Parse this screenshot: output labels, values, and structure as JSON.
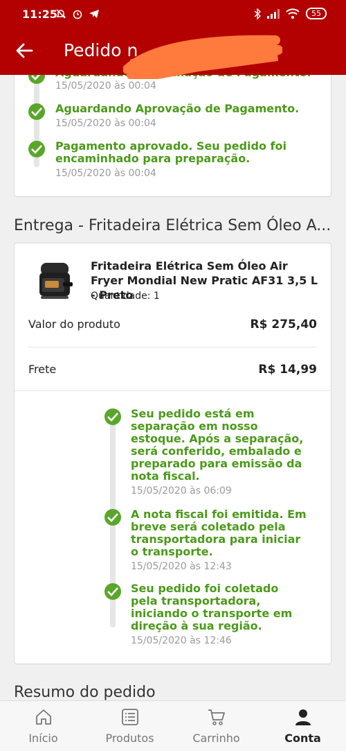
{
  "status": {
    "time": "11:25",
    "battery": "55"
  },
  "header": {
    "title": "Pedido n"
  },
  "payment_timeline": [
    {
      "text": "Aguardando Confirmação de Pagamento.",
      "date": "15/05/2020 às 00:04"
    },
    {
      "text": "Aguardando Aprovação de Pagamento.",
      "date": "15/05/2020 às 00:04"
    },
    {
      "text": "Pagamento aprovado. Seu pedido foi encaminhado para preparação.",
      "date": "15/05/2020 às 00:04"
    }
  ],
  "delivery": {
    "title": "Entrega - Fritadeira Elétrica Sem Óleo A...",
    "product_name": "Fritadeira Elétrica Sem Óleo Air Fryer Mondial New Pratic AF31 3,5 L - Preto",
    "quantity": "Quantidade: 1",
    "product_value_label": "Valor do produto",
    "product_value": "R$ 275,40",
    "shipping_label": "Frete",
    "shipping_value": "R$ 14,99",
    "timeline": [
      {
        "text": "Seu pedido está em separação em nosso estoque. Após a separação, será conferido, embalado e preparado para emissão da nota fiscal.",
        "date": "15/05/2020 às 06:09"
      },
      {
        "text": "A nota fiscal foi emitida. Em breve será coletado pela transportadora para iniciar o transporte.",
        "date": "15/05/2020 às 12:43"
      },
      {
        "text": "Seu pedido foi coletado pela transportadora, iniciando o transporte em direção à sua região.",
        "date": "15/05/2020 às 12:46"
      }
    ]
  },
  "summary": {
    "title": "Resumo do pedido"
  },
  "nav": [
    {
      "label": "Início",
      "icon": "home-icon"
    },
    {
      "label": "Produtos",
      "icon": "list-icon"
    },
    {
      "label": "Carrinho",
      "icon": "cart-icon"
    },
    {
      "label": "Conta",
      "icon": "user-icon"
    }
  ],
  "colors": {
    "brand": "#b30000",
    "success": "#4b9a1a",
    "check": "#5aa62a",
    "redaction": "#ff7a3d"
  }
}
